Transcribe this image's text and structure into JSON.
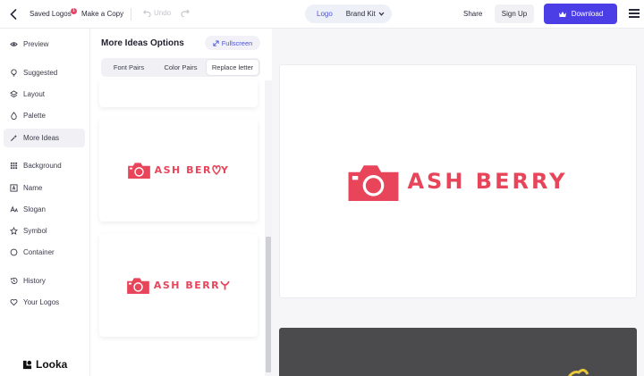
{
  "topbar": {
    "saved_logos": "Saved Logos",
    "saved_count": "1",
    "make_copy": "Make a Copy",
    "undo": "Undo",
    "logo_tab": "Logo",
    "brand_kit": "Brand Kit",
    "share": "Share",
    "sign_up": "Sign Up",
    "download": "Download"
  },
  "sidebar": {
    "items": [
      {
        "label": "Preview",
        "icon": "eye-icon"
      },
      {
        "label": "Suggested",
        "icon": "bulb-icon"
      },
      {
        "label": "Layout",
        "icon": "layers-icon"
      },
      {
        "label": "Palette",
        "icon": "drop-icon"
      },
      {
        "label": "More Ideas",
        "icon": "wand-icon"
      },
      {
        "label": "Background",
        "icon": "grid-icon"
      },
      {
        "label": "Name",
        "icon": "text-box-icon"
      },
      {
        "label": "Slogan",
        "icon": "slogan-icon"
      },
      {
        "label": "Symbol",
        "icon": "star-icon"
      },
      {
        "label": "Container",
        "icon": "circle-icon"
      },
      {
        "label": "History",
        "icon": "history-icon"
      },
      {
        "label": "Your Logos",
        "icon": "heart-icon"
      }
    ],
    "active": "More Ideas",
    "brand": "Looka"
  },
  "panel": {
    "title": "More Ideas Options",
    "fullscreen": "Fullscreen",
    "tabs": [
      "Font Pairs",
      "Color Pairs",
      "Replace letter"
    ],
    "active_tab": "Replace letter",
    "cards": [
      {
        "text_a": "ASH BER",
        "replaced": "R",
        "replacement_icon": "heart-stylized-icon"
      },
      {
        "text_a": "ASH BERR",
        "replaced": "Y",
        "replacement_icon": "y-stylized-icon"
      }
    ]
  },
  "preview": {
    "logo_text": "ASH BERRY"
  },
  "colors": {
    "accent": "#4b3ee6",
    "logo": "#e8455a",
    "badge": "#e8456b"
  }
}
